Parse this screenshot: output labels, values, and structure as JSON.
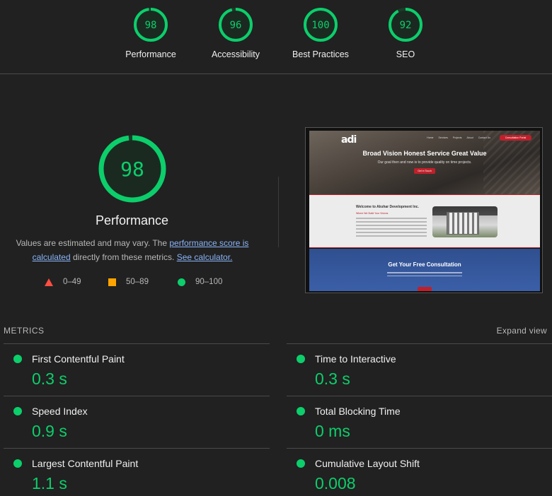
{
  "summary": {
    "gauges": [
      {
        "score": "98",
        "label": "Performance",
        "value": 98
      },
      {
        "score": "96",
        "label": "Accessibility",
        "value": 96
      },
      {
        "score": "100",
        "label": "Best Practices",
        "value": 100
      },
      {
        "score": "92",
        "label": "SEO",
        "value": 92
      }
    ]
  },
  "performance": {
    "score": "98",
    "value": 98,
    "title": "Performance",
    "desc_prefix": "Values are estimated and may vary. The ",
    "desc_link": "performance score is calculated",
    "desc_middle": " directly from these metrics. ",
    "desc_calc_link": "See calculator."
  },
  "legend": {
    "fail": "0–49",
    "average": "50–89",
    "pass": "90–100"
  },
  "colors": {
    "pass": "#0cce6b",
    "average": "#ffa400",
    "fail": "#ff4e42",
    "background": "#212121",
    "link": "#8ab4f8"
  },
  "thumbnail": {
    "logo": "adi",
    "nav": [
      "Home",
      "Services",
      "Projects",
      "About",
      "Contact Us"
    ],
    "nav_cta": "Consultation Portal",
    "hero_title": "Broad Vision Honest Service Great Value",
    "hero_sub": "Our goal then and now is to provide quality on time projects.",
    "hero_button": "Get in Touch",
    "welcome_title": "Welcome to Akshar Development Inc.",
    "welcome_sub": "Where We Build Your Visions",
    "consult_title": "Get Your Free Consultation"
  },
  "metrics": {
    "heading": "METRICS",
    "expand_label": "Expand view",
    "items": [
      {
        "label": "First Contentful Paint",
        "value": "0.3 s"
      },
      {
        "label": "Time to Interactive",
        "value": "0.3 s"
      },
      {
        "label": "Speed Index",
        "value": "0.9 s"
      },
      {
        "label": "Total Blocking Time",
        "value": "0 ms"
      },
      {
        "label": "Largest Contentful Paint",
        "value": "1.1 s"
      },
      {
        "label": "Cumulative Layout Shift",
        "value": "0.008"
      }
    ]
  }
}
